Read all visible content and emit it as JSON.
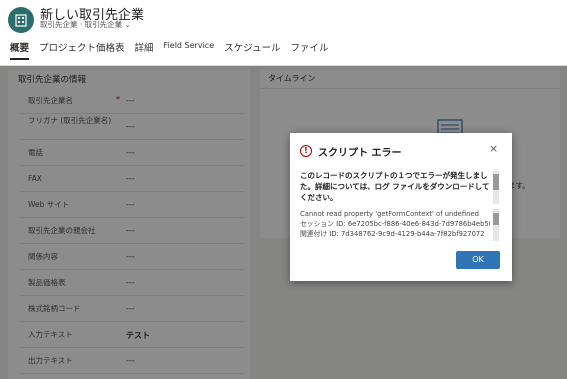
{
  "header": {
    "title": "新しい取引先企業",
    "subtitle": "取引先企業 · 取引先企業",
    "tabs": [
      "概要",
      "プロジェクト価格表",
      "詳細",
      "Field Service",
      "スケジュール",
      "ファイル"
    ]
  },
  "form": {
    "section_title": "取引先企業の情報",
    "fields": [
      {
        "label": "取引先企業名",
        "value": "---",
        "required": "*"
      },
      {
        "label": "フリガナ (取引先企業名)",
        "value": "---"
      },
      {
        "label": "電話",
        "value": "---"
      },
      {
        "label": "FAX",
        "value": "---"
      },
      {
        "label": "Web サイト",
        "value": "---"
      },
      {
        "label": "取引先企業の親会社",
        "value": "---"
      },
      {
        "label": "関係内容",
        "value": "---"
      },
      {
        "label": "製品価格表",
        "value": "---"
      },
      {
        "label": "株式銘柄コード",
        "value": "---"
      },
      {
        "label": "入力テキスト",
        "value": "テスト"
      },
      {
        "label": "出力テキスト",
        "value": "---"
      }
    ]
  },
  "timeline": {
    "title": "タイムライン",
    "message": "ます。"
  },
  "dialog": {
    "icon": "!",
    "title": "スクリプト エラー",
    "close": "×",
    "message": "このレコードのスクリプトの１つでエラーが発生しました。詳細については、ログ ファイルをダウンロードしてください。",
    "details": [
      "Cannot read property 'getFormContext' of undefined",
      "セッション ID: 6e7205bc-f886-40e6-843d-7d9786b4eb5f",
      "関連付け ID: 7d348762-9c9d-4129-b44a-7f82bf927072"
    ],
    "ok_label": "OK"
  },
  "colors": {
    "avatar": "#2c6e6e",
    "primary_button": "#2f74b5",
    "error": "#a80000"
  }
}
